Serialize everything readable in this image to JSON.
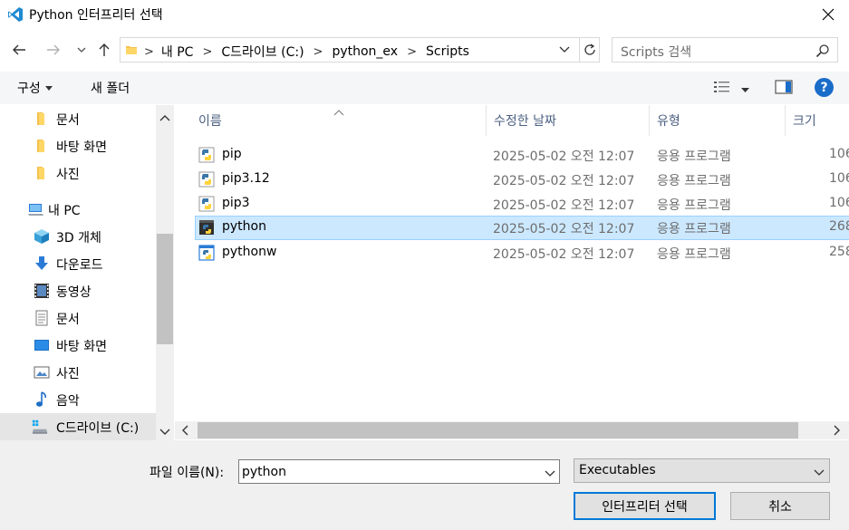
{
  "window": {
    "title": "Python 인터프리터 선택"
  },
  "address": {
    "crumbs": [
      "내 PC",
      "C드라이브 (C:)",
      "python_ex",
      "Scripts"
    ]
  },
  "search": {
    "placeholder": "Scripts 검색"
  },
  "toolbar": {
    "organize": "구성",
    "new_folder": "새 폴더"
  },
  "nav": {
    "items": [
      {
        "label": "문서",
        "icon": "folder-icon"
      },
      {
        "label": "바탕 화면",
        "icon": "folder-icon"
      },
      {
        "label": "사진",
        "icon": "folder-icon"
      },
      {
        "label": "내 PC",
        "icon": "computer-icon"
      },
      {
        "label": "3D 개체",
        "icon": "cube-icon"
      },
      {
        "label": "다운로드",
        "icon": "download-icon"
      },
      {
        "label": "동영상",
        "icon": "film-icon"
      },
      {
        "label": "문서",
        "icon": "document-icon"
      },
      {
        "label": "바탕 화면",
        "icon": "desktop-icon"
      },
      {
        "label": "사진",
        "icon": "picture-icon"
      },
      {
        "label": "음악",
        "icon": "music-icon"
      },
      {
        "label": "C드라이브 (C:)",
        "icon": "drive-icon"
      }
    ]
  },
  "columns": {
    "name": "이름",
    "date": "수정한 날짜",
    "type": "유형",
    "size": "크기"
  },
  "files": [
    {
      "name": "pip",
      "date": "2025-05-02 오전 12:07",
      "type": "응용 프로그램",
      "size": "106"
    },
    {
      "name": "pip3.12",
      "date": "2025-05-02 오전 12:07",
      "type": "응용 프로그램",
      "size": "106"
    },
    {
      "name": "pip3",
      "date": "2025-05-02 오전 12:07",
      "type": "응용 프로그램",
      "size": "106"
    },
    {
      "name": "python",
      "date": "2025-05-02 오전 12:07",
      "type": "응용 프로그램",
      "size": "268"
    },
    {
      "name": "pythonw",
      "date": "2025-05-02 오전 12:07",
      "type": "응용 프로그램",
      "size": "258"
    }
  ],
  "bottom": {
    "filename_label": "파일 이름(N):",
    "filename_value": "python",
    "filter_value": "Executables",
    "select_button": "인터프리터 선택",
    "cancel_button": "취소"
  },
  "colors": {
    "accent": "#0078d7",
    "selected_row": "#cce8ff",
    "help": "#1a6cc9"
  }
}
